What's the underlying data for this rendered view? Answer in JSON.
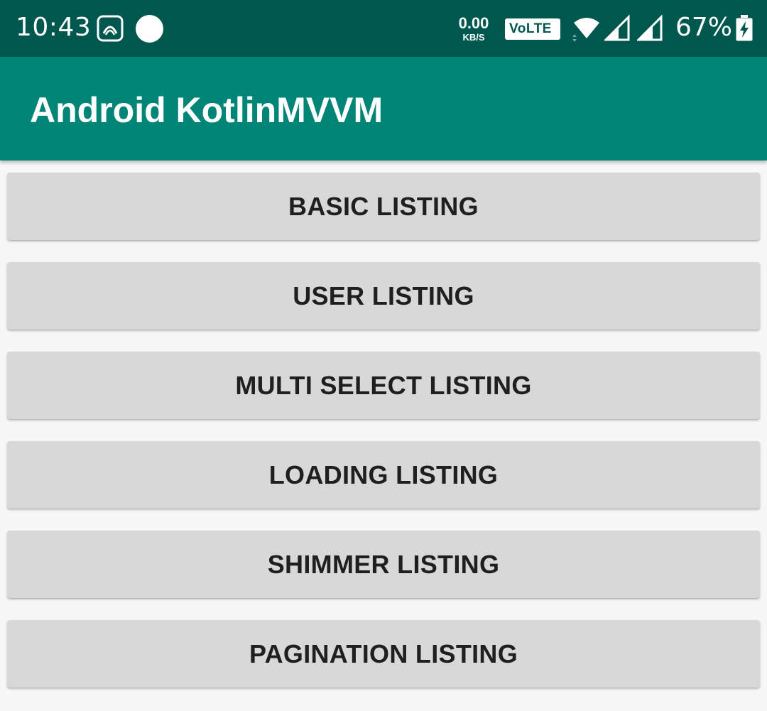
{
  "status_bar": {
    "time": "10:43",
    "net_speed_value": "0.00",
    "net_speed_unit": "KB/S",
    "volte": "VoLTE",
    "battery": "67%",
    "icons": [
      "saavn-icon",
      "notification-dot-icon",
      "wifi-icon",
      "signal-icon",
      "signal-icon",
      "battery-charging-icon"
    ]
  },
  "app_bar": {
    "title": "Android KotlinMVVM"
  },
  "buttons": [
    {
      "label": "BASIC LISTING"
    },
    {
      "label": "USER LISTING"
    },
    {
      "label": "MULTI SELECT LISTING"
    },
    {
      "label": "LOADING LISTING"
    },
    {
      "label": "SHIMMER LISTING"
    },
    {
      "label": "PAGINATION LISTING"
    }
  ],
  "colors": {
    "status_bar": "#00574d",
    "app_bar": "#008577",
    "button_bg": "#d7d8d7",
    "background": "#f7f7f7"
  }
}
